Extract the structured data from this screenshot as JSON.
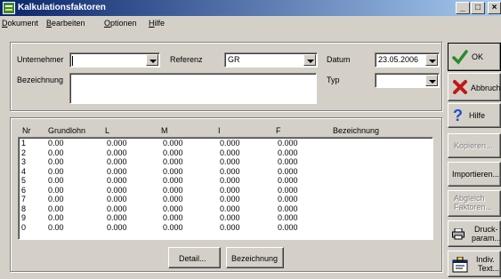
{
  "window": {
    "title": "Kalkulationsfaktoren",
    "minimize": "_",
    "maximize": "□",
    "close": "×"
  },
  "menu": [
    {
      "label": "Dokument",
      "accel": "D"
    },
    {
      "label": "Bearbeiten",
      "accel": "B"
    },
    {
      "label": "Optionen",
      "accel": "O"
    },
    {
      "label": "Hilfe",
      "accel": "H"
    }
  ],
  "form": {
    "unternehmer_label": "Unternehmer",
    "unternehmer_value": "",
    "referenz_label": "Referenz",
    "referenz_value": "GR",
    "datum_label": "Datum",
    "datum_value": "23.05.2006",
    "bezeichnung_label": "Bezeichnung",
    "bezeichnung_value": "",
    "typ_label": "Typ",
    "typ_value": ""
  },
  "table": {
    "headers": [
      "Nr",
      "Grundlohn",
      "L",
      "M",
      "I",
      "F",
      "Bezeichnung"
    ],
    "rows": [
      [
        "1",
        "0.00",
        "0.000",
        "0.000",
        "0.000",
        "0.000",
        ""
      ],
      [
        "2",
        "0.00",
        "0.000",
        "0.000",
        "0.000",
        "0.000",
        ""
      ],
      [
        "3",
        "0.00",
        "0.000",
        "0.000",
        "0.000",
        "0.000",
        ""
      ],
      [
        "4",
        "0.00",
        "0.000",
        "0.000",
        "0.000",
        "0.000",
        ""
      ],
      [
        "5",
        "0.00",
        "0.000",
        "0.000",
        "0.000",
        "0.000",
        ""
      ],
      [
        "6",
        "0.00",
        "0.000",
        "0.000",
        "0.000",
        "0.000",
        ""
      ],
      [
        "7",
        "0.00",
        "0.000",
        "0.000",
        "0.000",
        "0.000",
        ""
      ],
      [
        "8",
        "0.00",
        "0.000",
        "0.000",
        "0.000",
        "0.000",
        ""
      ],
      [
        "9",
        "0.00",
        "0.000",
        "0.000",
        "0.000",
        "0.000",
        ""
      ],
      [
        "0",
        "0.00",
        "0.000",
        "0.000",
        "0.000",
        "0.000",
        ""
      ]
    ],
    "detail_button": "Detail...",
    "bezeichnung_button": "Bezeichnung"
  },
  "side_buttons": {
    "ok": "OK",
    "abbruch": "Abbruch",
    "hilfe": "Hilfe",
    "kopieren": "Kopieren...",
    "importieren": "Importieren...",
    "abgleich_line1": "Abgleich",
    "abgleich_line2": "Faktoren...",
    "druck_line1": "Druck-",
    "druck_line2": "param...",
    "indiv_line1": "Indiv.",
    "indiv_line2": "Text..."
  },
  "colors": {
    "title_bar": "#0a246a",
    "ok_check": "#2a8a2a",
    "abbruch_x": "#c01818",
    "hilfe_q": "#1a50c8"
  }
}
